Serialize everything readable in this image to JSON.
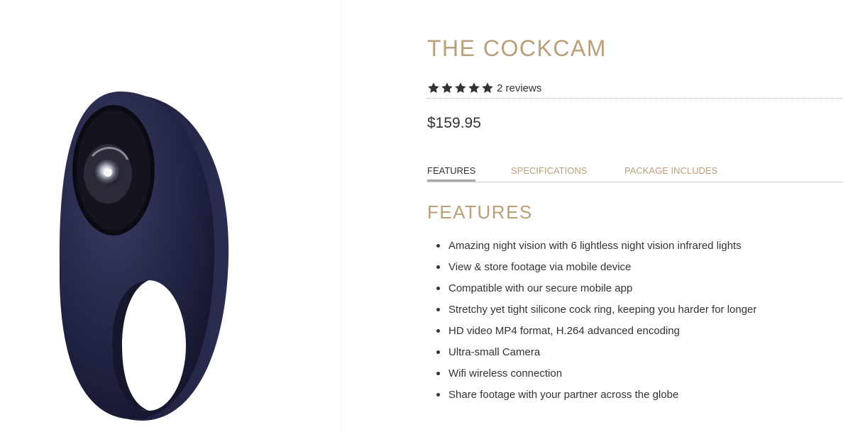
{
  "product": {
    "title": "THE COCKCAM",
    "rating": 5,
    "rating_max": 5,
    "reviews_label": "2 reviews",
    "price": "$159.95",
    "image_icon": "camera-ring-product-image"
  },
  "tabs": [
    {
      "label": "FEATURES",
      "active": true
    },
    {
      "label": "SPECIFICATIONS",
      "active": false
    },
    {
      "label": "PACKAGE INCLUDES",
      "active": false
    }
  ],
  "features_section": {
    "heading": "FEATURES",
    "items": [
      "Amazing night vision with 6 lightless night vision infrared lights",
      "View & store footage via mobile device",
      "Compatible with our secure mobile app",
      "Stretchy yet tight silicone cock ring, keeping you harder for longer",
      "HD video MP4 format, H.264 advanced encoding",
      "Ultra-small Camera",
      "Wifi wireless connection",
      "Share footage with your partner across the globe"
    ]
  },
  "colors": {
    "accent": "#bb9f79",
    "text": "#333333",
    "star": "#333333",
    "product": "#1e2038"
  }
}
